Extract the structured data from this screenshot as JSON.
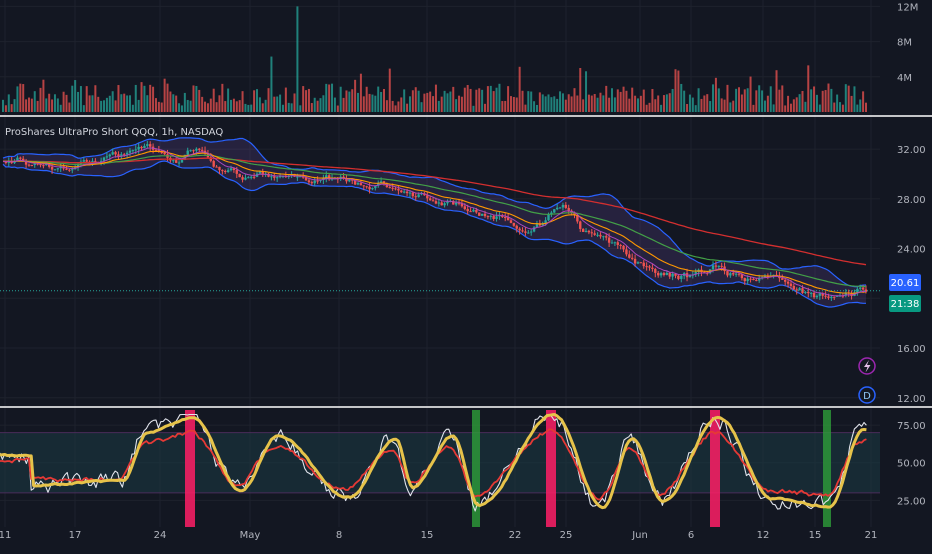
{
  "legend": {
    "title": "ProShares UltraPro Short QQQ, 1h, NASDAQ"
  },
  "price_badges": {
    "last_price": "20.61",
    "countdown": "21:38"
  },
  "colors": {
    "background": "#131722",
    "grid": "#1e222d",
    "separator": "#ffffff",
    "up": "#26a69a",
    "down": "#ef5350",
    "bb": "#2962ff",
    "ema_red": "#d32f2f",
    "ema_green": "#43a047",
    "ema_orange": "#ff9800",
    "osc_white": "#e0e3eb",
    "osc_red": "#e53935",
    "osc_yellow": "#e6c34a",
    "zone_fill": "#1b3a44",
    "signal_red": "#ff1e66",
    "signal_green": "#2e9e3a",
    "badge_blue": "#2962ff",
    "badge_teal": "#089981"
  },
  "icons": {
    "lightning": "lightning-icon",
    "dividend": "d-icon",
    "dividend_letter": "D"
  },
  "chart_data": [
    {
      "type": "bar",
      "title": "",
      "panel": "volume",
      "ylim": [
        0,
        12500000
      ],
      "y_ticks": [
        "4M",
        "8M",
        "12M"
      ],
      "y_tick_values": [
        4000000,
        8000000,
        12000000
      ],
      "bars_shown": 300,
      "spike_values": [
        12000000,
        6300000,
        5300000,
        5000000
      ]
    },
    {
      "type": "candlestick",
      "title": "ProShares UltraPro Short QQQ, 1h, NASDAQ",
      "panel": "price",
      "ylim": [
        11.5,
        34.5
      ],
      "y_ticks": [
        "12.00",
        "16.00",
        "20.00",
        "24.00",
        "28.00",
        "32.00"
      ],
      "y_tick_values": [
        12,
        16,
        20,
        24,
        28,
        32
      ],
      "x_ticks": [
        "11",
        "17",
        "24",
        "May",
        "8",
        "15",
        "22",
        "25",
        "Jun",
        "6",
        "12",
        "15",
        "21"
      ],
      "last_price": 20.61,
      "close_path_anchors": [
        {
          "x": "11",
          "y": 31.3
        },
        {
          "x": "17",
          "y": 30.6
        },
        {
          "x": "24",
          "y": 31.7
        },
        {
          "x": "May",
          "y": 29.7
        },
        {
          "x": "8",
          "y": 29.5
        },
        {
          "x": "15",
          "y": 28.4
        },
        {
          "x": "22",
          "y": 26.0
        },
        {
          "x": "25",
          "y": 26.4
        },
        {
          "x": "Jun",
          "y": 22.5
        },
        {
          "x": "6",
          "y": 21.8
        },
        {
          "x": "12",
          "y": 21.4
        },
        {
          "x": "15",
          "y": 20.0
        },
        {
          "x": "21",
          "y": 20.6
        }
      ],
      "overlays": [
        "bollinger_upper",
        "bollinger_lower",
        "ema_red",
        "ema_green",
        "ema_orange"
      ]
    },
    {
      "type": "line",
      "title": "",
      "panel": "oscillator",
      "ylim": [
        12,
        85
      ],
      "y_ticks": [
        "25.00",
        "50.00",
        "75.00"
      ],
      "y_tick_values": [
        25,
        50,
        75
      ],
      "zone": [
        30,
        70
      ],
      "series": [
        {
          "color": "#e0e3eb"
        },
        {
          "color": "#e53935"
        },
        {
          "color": "#e6c34a"
        }
      ],
      "signals_red": [
        "24",
        "25",
        "6"
      ],
      "signals_green": [
        "22",
        "15"
      ]
    }
  ]
}
